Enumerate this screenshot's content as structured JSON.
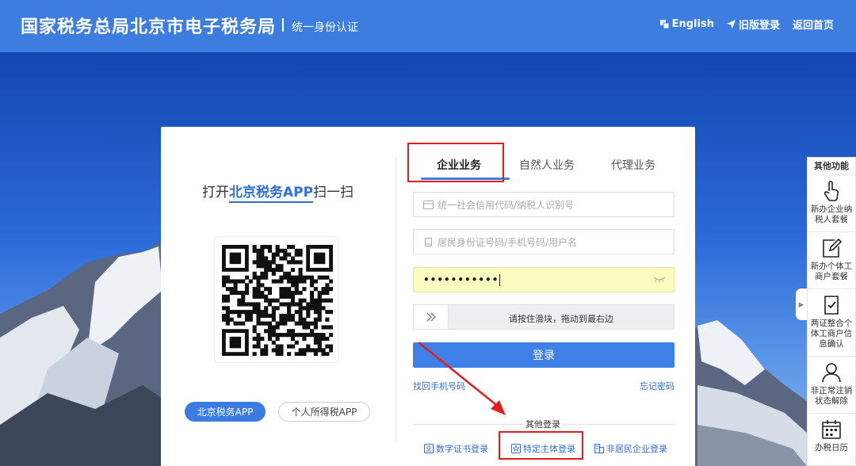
{
  "header": {
    "title": "国家税务总局北京市电子税务局",
    "subtitle": "统一身份认证",
    "nav": [
      {
        "label": "English",
        "icon": "language-icon"
      },
      {
        "label": "旧版登录",
        "icon": "send-icon"
      },
      {
        "label": "返回首页",
        "icon": ""
      }
    ]
  },
  "qr": {
    "prefix": "打开",
    "app_name": "北京税务APP",
    "suffix": "扫一扫",
    "app_buttons": [
      "北京税务APP",
      "个人所得税APP"
    ]
  },
  "tabs": [
    "企业业务",
    "自然人业务",
    "代理业务"
  ],
  "active_tab": 0,
  "form": {
    "credit_code_placeholder": "统一社会信用代码/纳税人识别号",
    "id_placeholder": "居民身份证号码/手机号码/用户名",
    "password_value": "•••••••••••",
    "slider_text": "请按住滑块，拖动到最右边",
    "login_label": "登录",
    "link_phone": "找回手机号码",
    "link_forgot": "忘记密码"
  },
  "other_login": {
    "title": "其他登录",
    "options": [
      {
        "label": "数字证书登录",
        "icon": "certificate-icon"
      },
      {
        "label": "特定主体登录",
        "icon": "star-badge-icon"
      },
      {
        "label": "非居民企业登录",
        "icon": "enterprise-icon"
      }
    ]
  },
  "sidebar": {
    "title": "其他功能",
    "items": [
      {
        "label": "新办企业纳税人套餐",
        "icon": "hand-pointer-icon"
      },
      {
        "label": "新办个体工商户套餐",
        "icon": "edit-doc-icon"
      },
      {
        "label": "两证整合个体工商户信息确认",
        "icon": "check-doc-icon"
      },
      {
        "label": "非正常注销状态解除",
        "icon": "user-icon"
      },
      {
        "label": "办税日历",
        "icon": "calendar-icon"
      }
    ]
  },
  "colors": {
    "header_bg": "#3d7de0",
    "primary": "#3f80e6",
    "link": "#2f6fd8",
    "highlight_box": "#e02020",
    "password_bg": "#fbfcc0"
  }
}
